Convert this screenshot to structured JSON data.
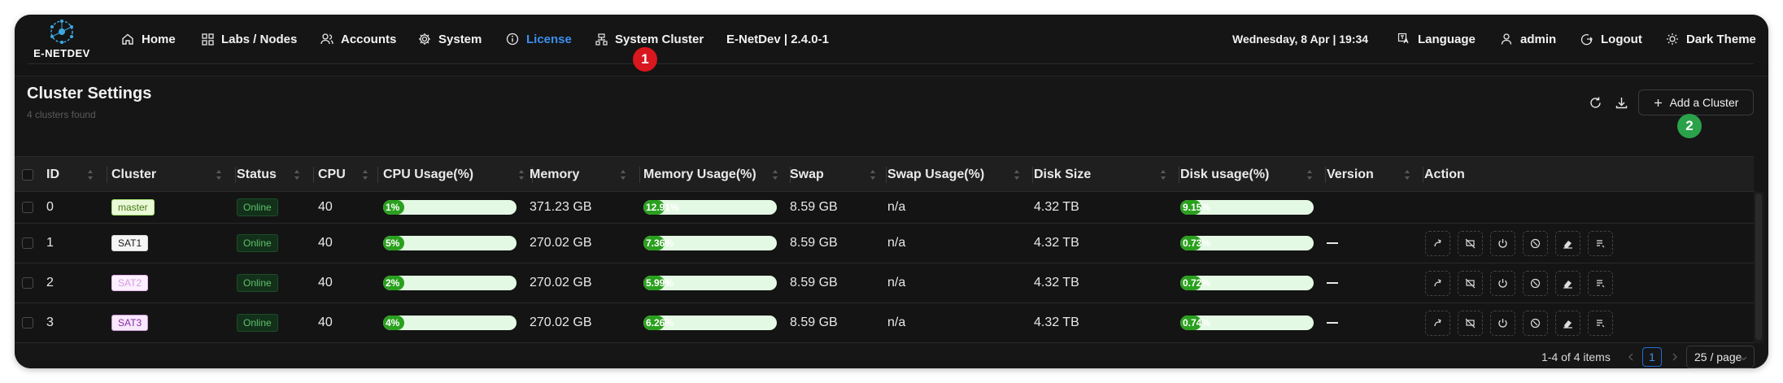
{
  "brand": {
    "name": "E-NETDEV"
  },
  "nav": {
    "items": [
      {
        "label": "Home",
        "icon": "home-icon"
      },
      {
        "label": "Labs / Nodes",
        "icon": "grid-icon"
      },
      {
        "label": "Accounts",
        "icon": "users-icon"
      },
      {
        "label": "System",
        "icon": "gear-icon"
      },
      {
        "label": "License",
        "icon": "info-icon",
        "active": true
      },
      {
        "label": "System Cluster",
        "icon": "cluster-icon"
      }
    ],
    "version": "E-NetDev | 2.4.0-1",
    "datetime": "Wednesday, 8 Apr | 19:34",
    "language": "Language",
    "user": "admin",
    "logout": "Logout",
    "theme": "Dark Theme"
  },
  "annotations": {
    "badge1": "1",
    "badge2": "2"
  },
  "page": {
    "title": "Cluster Settings",
    "subtitle": "4 clusters found",
    "add_label": "Add a Cluster"
  },
  "table": {
    "headers": [
      "ID",
      "Cluster",
      "Status",
      "CPU",
      "CPU Usage(%)",
      "Memory",
      "Memory Usage(%)",
      "Swap",
      "Swap Usage(%)",
      "Disk Size",
      "Disk usage(%)",
      "Version",
      "Action"
    ],
    "rows": [
      {
        "id": "0",
        "cluster": "master",
        "tag_color": "#a6e36b",
        "status": "Online",
        "cpu": "40",
        "cpu_usage": "1%",
        "cpu_pct": 1,
        "memory": "371.23 GB",
        "mem_usage": "12.91%",
        "mem_pct": 12.91,
        "swap": "8.59 GB",
        "swap_usage": "n/a",
        "disk": "4.32 TB",
        "disk_usage": "9.15%",
        "disk_pct": 9.15,
        "version": "",
        "has_actions": false
      },
      {
        "id": "1",
        "cluster": "SAT1",
        "tag_color": "#1a1a1a",
        "status": "Online",
        "cpu": "40",
        "cpu_usage": "5%",
        "cpu_pct": 5,
        "memory": "270.02 GB",
        "mem_usage": "7.36%",
        "mem_pct": 7.36,
        "swap": "8.59 GB",
        "swap_usage": "n/a",
        "disk": "4.32 TB",
        "disk_usage": "0.73%",
        "disk_pct": 0.73,
        "version": "—",
        "has_actions": true
      },
      {
        "id": "2",
        "cluster": "SAT2",
        "tag_color": "#e8b8f0",
        "status": "Online",
        "cpu": "40",
        "cpu_usage": "2%",
        "cpu_pct": 2,
        "memory": "270.02 GB",
        "mem_usage": "5.99%",
        "mem_pct": 5.99,
        "swap": "8.59 GB",
        "swap_usage": "n/a",
        "disk": "4.32 TB",
        "disk_usage": "0.72%",
        "disk_pct": 0.72,
        "version": "—",
        "has_actions": true
      },
      {
        "id": "3",
        "cluster": "SAT3",
        "tag_color": "#8a2aa8",
        "status": "Online",
        "cpu": "40",
        "cpu_usage": "4%",
        "cpu_pct": 4,
        "memory": "270.02 GB",
        "mem_usage": "6.26%",
        "mem_pct": 6.26,
        "swap": "8.59 GB",
        "swap_usage": "n/a",
        "disk": "4.32 TB",
        "disk_usage": "0.74%",
        "disk_pct": 0.74,
        "version": "—",
        "has_actions": true
      }
    ],
    "action_icons": [
      "console-icon",
      "wipe-display-icon",
      "power-icon",
      "stop-icon",
      "erase-icon",
      "log-icon"
    ]
  },
  "pagination": {
    "summary": "1-4 of 4 items",
    "current_page": "1",
    "page_size": "25 / page"
  },
  "colors": {
    "accent": "#3b8ff0",
    "usage_bar": "#2aa01e",
    "usage_track": "#e4f9e4",
    "online": "#5fc06a",
    "badge_red": "#d9171e",
    "badge_green": "#2aa24a"
  }
}
